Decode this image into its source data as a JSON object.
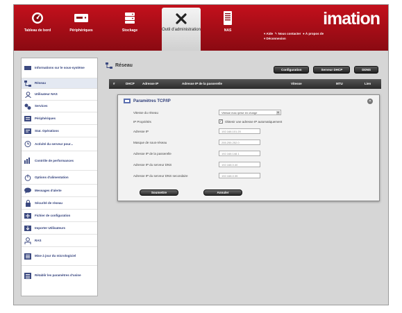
{
  "header": {
    "brand": "imation",
    "nav": [
      {
        "label": "Tableau de bord",
        "icon": "dashboard-icon"
      },
      {
        "label": "Périphériques",
        "icon": "devices-icon"
      },
      {
        "label": "Stockage",
        "icon": "storage-icon"
      },
      {
        "label": "Outil d'administration",
        "icon": "tools-icon"
      },
      {
        "label": "NAS",
        "icon": "nas-icon"
      }
    ],
    "links": {
      "aide": "Aide",
      "contact": "Nous contacter",
      "apropos": "À propos de",
      "deconnexion": "Déconnexion"
    }
  },
  "sidebar": {
    "items": [
      {
        "label": "Informations sur le sous-système",
        "icon": "info-icon"
      },
      {
        "label": "Réseau",
        "icon": "network-icon",
        "active": true
      },
      {
        "label": "Utilisateur NAS",
        "icon": "user-icon"
      },
      {
        "label": "Services",
        "icon": "services-icon"
      },
      {
        "label": "Périphériques",
        "icon": "hardware-icon"
      },
      {
        "label": "Stat. Opérations",
        "icon": "stats-icon"
      },
      {
        "label": "Activité du serveur pour...",
        "icon": "activity-icon"
      },
      {
        "label": "Contrôle de performances",
        "icon": "performance-icon"
      },
      {
        "label": "Options d'alimentation",
        "icon": "power-icon"
      },
      {
        "label": "Messages d'alerte",
        "icon": "alert-icon"
      },
      {
        "label": "Sécurité de réseau",
        "icon": "lock-icon"
      },
      {
        "label": "Fichier de configuration",
        "icon": "config-icon"
      },
      {
        "label": "Importer Utilisateurs",
        "icon": "import-icon"
      },
      {
        "label": "RAS",
        "icon": "ras-icon"
      },
      {
        "label": "Mise à jour du micrologiciel",
        "icon": "update-icon"
      },
      {
        "label": "Rétablir les paramètres d'usine",
        "icon": "reset-icon"
      }
    ]
  },
  "main": {
    "title": "Réseau",
    "toolbar": [
      "Configuration",
      "Serveur DHCP",
      "DDNS"
    ],
    "table_headers": [
      "#",
      "DHCP",
      "Adresse IP",
      "Adresse IP de la passerelle",
      "Vitesse",
      "MTU",
      "Lien"
    ]
  },
  "dialog": {
    "title": "Paramètres TCP/IP",
    "mode_label": "Vitesse du réseau",
    "mode_value": "Vitesse max./prise en charge",
    "ip_props_label": "IP Propriétés",
    "auto_ip_label": "Obtenir une adresse IP automatiquement",
    "auto_ip_checked": true,
    "fields": [
      {
        "label": "Adresse IP",
        "value": "192.168.101.20"
      },
      {
        "label": "Masque de sous-réseau",
        "value": "255.255.252.0"
      },
      {
        "label": "Adresse IP de la passerelle",
        "value": "192.168.148.1"
      },
      {
        "label": "Adresse IP du serveur DNS",
        "value": "192.168.0.40"
      },
      {
        "label": "Adresse IP du serveur DNS secondaire",
        "value": "192.168.0.35"
      }
    ],
    "submit_label": "Soumettre",
    "cancel_label": "Annuler"
  },
  "colors": {
    "header": "#b30f1a",
    "accent": "#2d3c78",
    "button": "#2a2a2a"
  }
}
